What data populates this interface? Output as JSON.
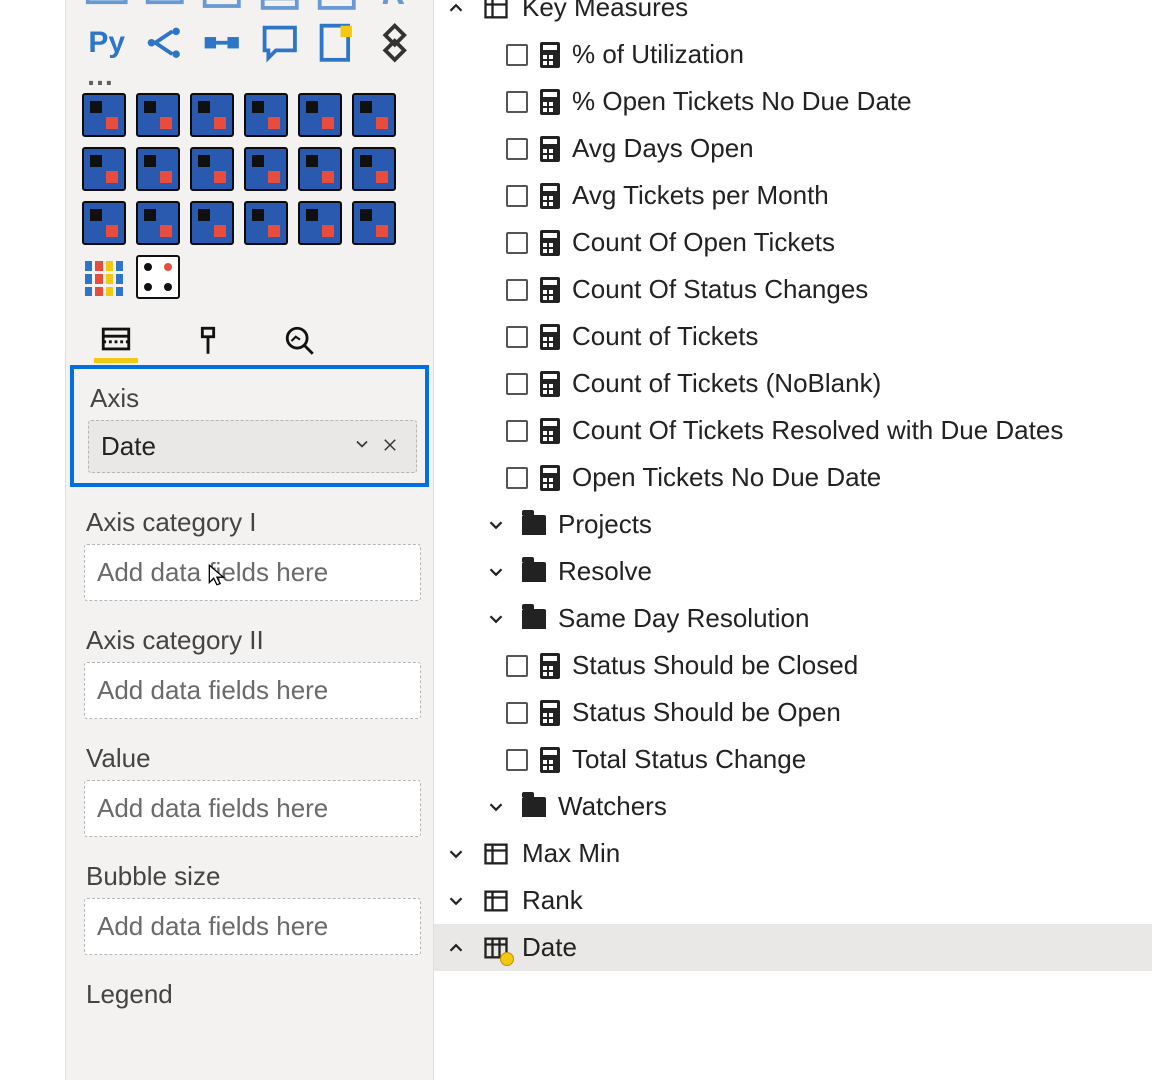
{
  "viz_icons_row1": [
    "line-bar",
    "card",
    "kpi",
    "table",
    "matrix",
    "r"
  ],
  "viz_icons_row2": [
    "py",
    "decomp",
    "keyinfluencer",
    "qa",
    "paginated",
    "diamond-sparkle"
  ],
  "wells": {
    "axis": {
      "label": "Axis",
      "value": "Date"
    },
    "axis_cat_1": {
      "label": "Axis category I",
      "placeholder": "Add data fields here"
    },
    "axis_cat_2": {
      "label": "Axis category II",
      "placeholder": "Add data fields here"
    },
    "value": {
      "label": "Value",
      "placeholder": "Add data fields here"
    },
    "bubble": {
      "label": "Bubble size",
      "placeholder": "Add data fields here"
    },
    "legend": {
      "label": "Legend"
    }
  },
  "fields": {
    "key_measures": {
      "label": "Key Measures",
      "items": [
        "% of Utilization",
        "% Open Tickets No Due Date",
        "Avg Days Open",
        "Avg Tickets per Month",
        "Count Of Open Tickets",
        "Count Of Status Changes",
        "Count of Tickets",
        "Count of Tickets (NoBlank)",
        "Count Of Tickets Resolved with Due Dates",
        "Open Tickets No Due Date"
      ]
    },
    "folders": [
      {
        "name": "Projects"
      },
      {
        "name": "Resolve"
      },
      {
        "name": "Same Day Resolution"
      }
    ],
    "status_measures": [
      "Status Should be Closed",
      "Status Should be Open",
      "Total Status Change"
    ],
    "folders2": [
      {
        "name": "Watchers"
      }
    ],
    "tables": [
      {
        "name": "Max Min"
      },
      {
        "name": "Rank"
      }
    ],
    "date_table": "Date"
  }
}
